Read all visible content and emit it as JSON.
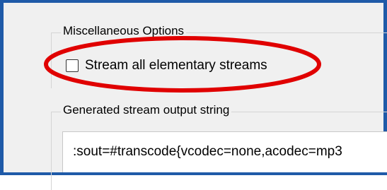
{
  "misc_options": {
    "title": "Miscellaneous Options",
    "stream_all_checkbox": {
      "label": "Stream all elementary streams",
      "checked": false
    }
  },
  "output_string": {
    "title": "Generated stream output string",
    "value": ":sout=#transcode{vcodec=none,acodec=mp3"
  },
  "annotation": {
    "color": "#e00000"
  },
  "colors": {
    "window_border": "#1f5aa8",
    "panel_background": "#f0f0f0"
  }
}
